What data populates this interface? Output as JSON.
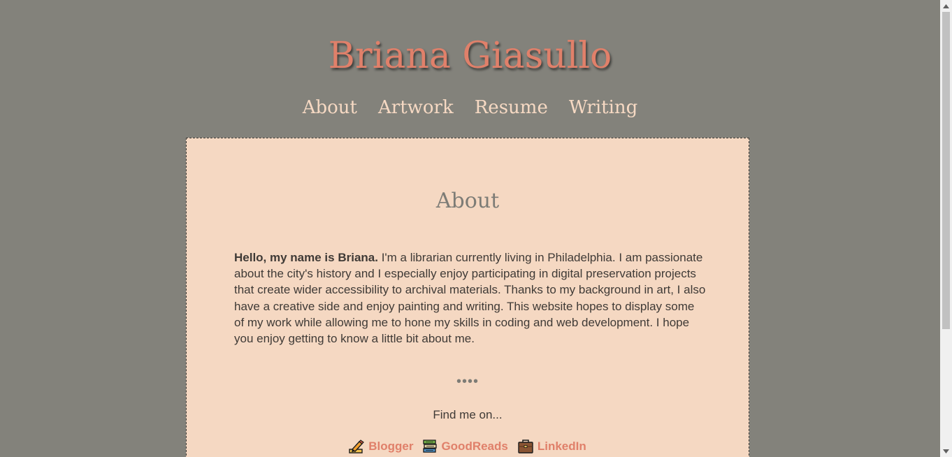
{
  "site": {
    "title": "Briana Giasullo"
  },
  "nav": {
    "items": [
      {
        "label": "About"
      },
      {
        "label": "Artwork"
      },
      {
        "label": "Resume"
      },
      {
        "label": "Writing"
      }
    ]
  },
  "main": {
    "title": "About",
    "intro_bold": "Hello, my name is Briana.",
    "intro_text": " I'm a librarian currently living in Philadelphia. I am passionate about the city's history and I especially enjoy participating in digital preservation projects that create wider accessibility to archival materials. Thanks to my background in art, I also have a creative side and enjoy painting and writing. This website hopes to display some of my work while allowing me to hone my skills in coding and web development. I hope you enjoy getting to know a little bit about me.",
    "divider": "••••",
    "find_me": "Find me on...",
    "links": [
      {
        "label": "Blogger",
        "icon": "pencil-icon"
      },
      {
        "label": "GoodReads",
        "icon": "books-icon"
      },
      {
        "label": "LinkedIn",
        "icon": "briefcase-icon"
      }
    ]
  },
  "colors": {
    "background": "#83827b",
    "panel": "#f5d8c2",
    "accent": "#e0806a",
    "nav_text": "#f6d9c3",
    "body_text": "#3f3a36",
    "heading": "#7d7c76"
  }
}
